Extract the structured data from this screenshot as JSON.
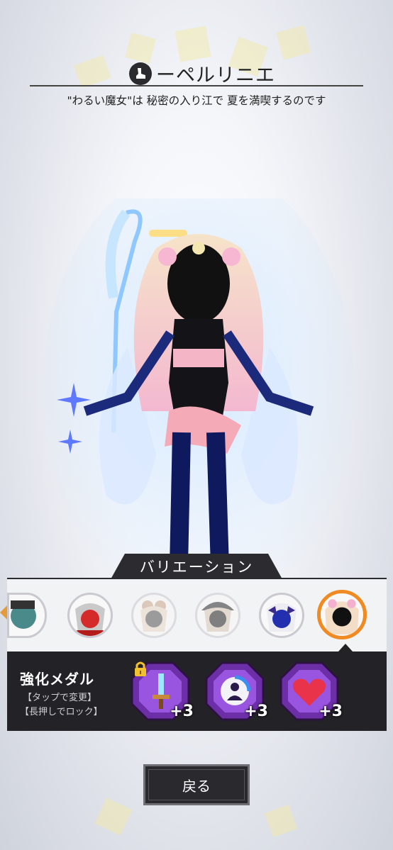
{
  "header": {
    "title": "ーペルリニエ",
    "title_icon": "boot-icon",
    "subtitle": "\"わるい魔女\"は 秘密の入り江で 夏を満喫するのです"
  },
  "variation": {
    "label": "バリエーション",
    "avatars": [
      {
        "name": "variation-avatar-1",
        "state": "partial"
      },
      {
        "name": "variation-avatar-2",
        "state": "normal"
      },
      {
        "name": "variation-avatar-3",
        "state": "faded"
      },
      {
        "name": "variation-avatar-4",
        "state": "faded"
      },
      {
        "name": "variation-avatar-5",
        "state": "normal"
      },
      {
        "name": "variation-avatar-6",
        "state": "selected"
      }
    ]
  },
  "medals": {
    "label": "強化メダル",
    "hint_tap": "【タップで変更】",
    "hint_hold": "【長押しでロック】",
    "items": [
      {
        "icon": "sword-icon",
        "bonus": "+3",
        "locked": true
      },
      {
        "icon": "person-icon",
        "bonus": "+3",
        "locked": false
      },
      {
        "icon": "heart-icon",
        "bonus": "+3",
        "locked": false
      }
    ]
  },
  "back_button": "戻る",
  "colors": {
    "accent_orange": "#f08a22",
    "medal_purple": "#8a3fc9",
    "panel_dark": "#232327"
  }
}
